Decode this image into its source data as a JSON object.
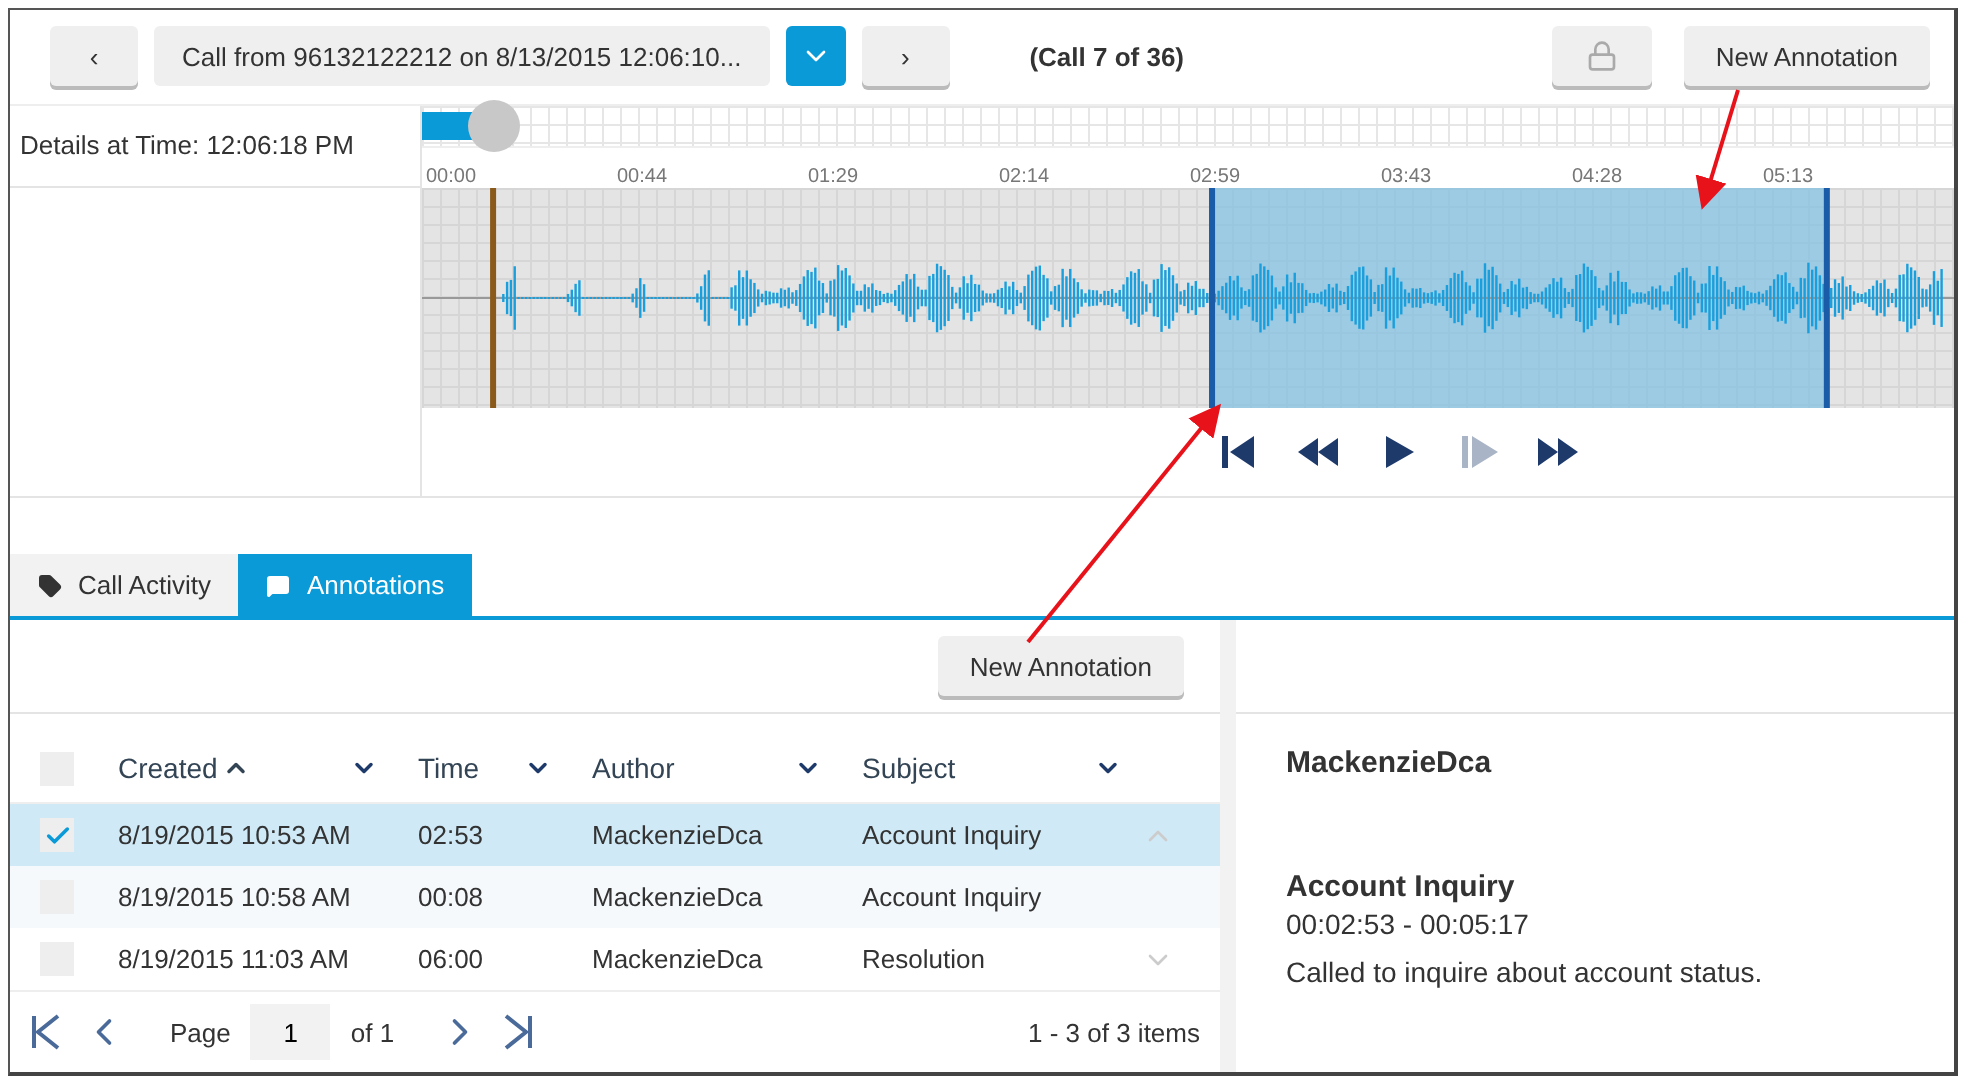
{
  "toolbar": {
    "prev_label": "‹",
    "call_title": "Call from 96132122212 on 8/13/2015 12:06:10...",
    "next_label": "›",
    "call_counter": "(Call 7 of 36)",
    "new_annotation": "New Annotation"
  },
  "timeline": {
    "details_label": "Details at Time: 12:06:18 PM",
    "progress": {
      "level": 0.047
    },
    "ticks": [
      "00:00",
      "00:44",
      "01:29",
      "02:14",
      "02:59",
      "03:43",
      "04:28",
      "05:13"
    ]
  },
  "playback": [
    {
      "kind": "skip-start",
      "disabled": false
    },
    {
      "kind": "rewind",
      "disabled": false
    },
    {
      "kind": "play",
      "disabled": false
    },
    {
      "kind": "step",
      "disabled": true
    },
    {
      "kind": "forward",
      "disabled": false
    }
  ],
  "tabs": [
    {
      "label": "Call Activity",
      "kind": "tag",
      "selected": false
    },
    {
      "label": "Annotations",
      "kind": "comment",
      "selected": true
    }
  ],
  "annotations": {
    "new_annotation": "New Annotation",
    "select_all": {
      "checked": false
    },
    "columns": [
      {
        "label": "Created",
        "sorted": true
      },
      {
        "label": "Time",
        "sorted": false
      },
      {
        "label": "Author",
        "sorted": false
      },
      {
        "label": "Subject",
        "sorted": false
      }
    ],
    "rows": [
      {
        "created": "8/19/2015 10:53 AM",
        "time": "02:53",
        "author": "MackenzieDca",
        "subject": "Account Inquiry",
        "selected": true,
        "checked": true
      },
      {
        "created": "8/19/2015 10:58 AM",
        "time": "00:08",
        "author": "MackenzieDca",
        "subject": "Account Inquiry",
        "selected": false,
        "checked": false
      },
      {
        "created": "8/19/2015 11:03 AM",
        "time": "06:00",
        "author": "MackenzieDca",
        "subject": "Resolution",
        "selected": false,
        "checked": false
      }
    ],
    "pager": {
      "page_label": "Page",
      "page": "1",
      "of_label": "of 1",
      "summary": "1 - 3 of 3 items"
    }
  },
  "detail": {
    "author": "MackenzieDca",
    "subject": "Account Inquiry",
    "range": "00:02:53 - 00:05:17",
    "note": "Called to inquire about account status."
  }
}
